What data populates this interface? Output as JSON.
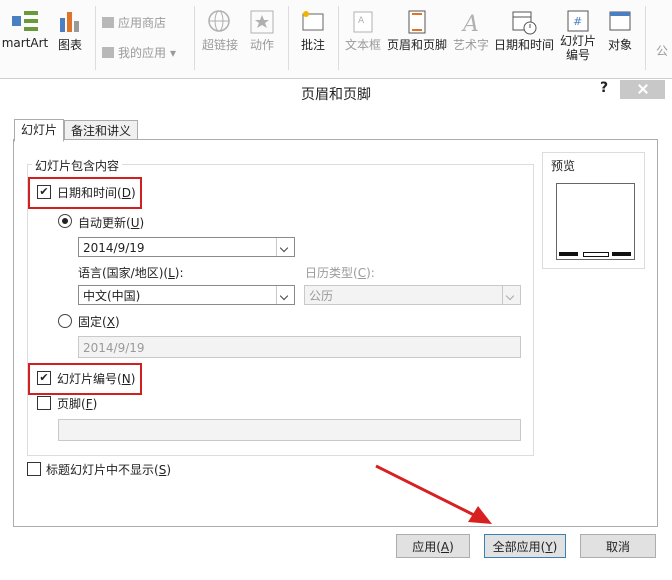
{
  "ribbon": {
    "smartart": "martArt",
    "chart": "图表",
    "app_store": "应用商店",
    "my_apps": "我的应用",
    "hyperlink": "超链接",
    "action": "动作",
    "comment": "批注",
    "textbox": "文本框",
    "header_footer": "页眉和页脚",
    "wordart": "艺术字",
    "date_time": "日期和时间",
    "slide_number_line1": "幻灯片",
    "slide_number_line2": "编号",
    "object": "对象",
    "partial": "公"
  },
  "dialog": {
    "title": "页眉和页脚",
    "help": "?",
    "tabs": [
      "幻灯片",
      "备注和讲义"
    ],
    "group_label": "幻灯片包含内容",
    "preview_label": "预览",
    "date_time_label": "日期和时间",
    "date_time_key": "D",
    "auto_update_label": "自动更新",
    "auto_update_key": "U",
    "auto_date_value": "2014/9/19",
    "language_label": "语言(国家/地区)",
    "language_key": "L",
    "language_value": "中文(中国)",
    "calendar_label": "日历类型",
    "calendar_key": "C",
    "calendar_value": "公历",
    "fixed_label": "固定",
    "fixed_key": "X",
    "fixed_value": "2014/9/19",
    "slide_number_label": "幻灯片编号",
    "slide_number_key": "N",
    "footer_label": "页脚",
    "footer_key": "F",
    "footer_value": "",
    "dont_show_title_label": "标题幻灯片中不显示",
    "dont_show_title_key": "S",
    "apply_label": "应用",
    "apply_key": "A",
    "apply_all_label": "全部应用",
    "apply_all_key": "Y",
    "cancel_label": "取消",
    "date_time_checked": true,
    "auto_update_selected": true,
    "slide_number_checked": true,
    "footer_checked": false,
    "dont_show_title_checked": false
  },
  "colors": {
    "highlight_box": "#d02020",
    "arrow": "#d82020"
  }
}
